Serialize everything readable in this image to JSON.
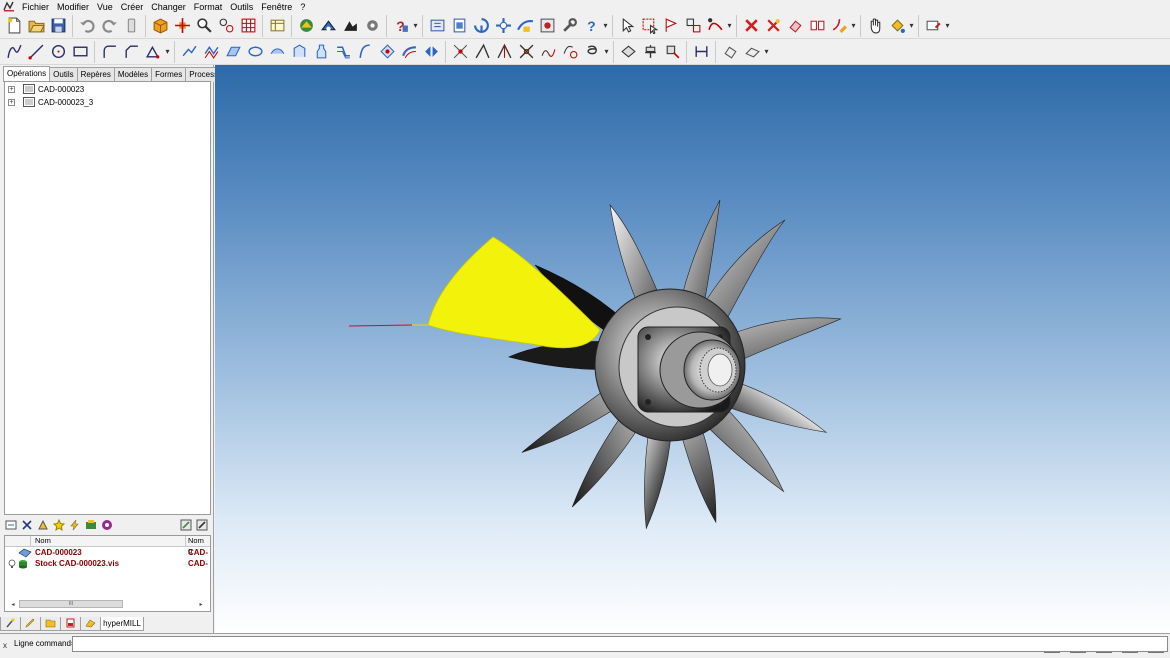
{
  "menu": {
    "items": [
      {
        "label": "Fichier"
      },
      {
        "label": "Modifier"
      },
      {
        "label": "Vue"
      },
      {
        "label": "Créer"
      },
      {
        "label": "Changer"
      },
      {
        "label": "Format"
      },
      {
        "label": "Outils"
      },
      {
        "label": "Fenêtre"
      },
      {
        "label": "?"
      }
    ]
  },
  "left_panel": {
    "tabs": [
      {
        "label": "Opérations"
      },
      {
        "label": "Outils"
      },
      {
        "label": "Repères"
      },
      {
        "label": "Modèles"
      },
      {
        "label": "Formes"
      },
      {
        "label": "Processus"
      }
    ],
    "tree": [
      {
        "label": "CAD-000023",
        "expand": "+"
      },
      {
        "label": "CAD-000023_3",
        "expand": "+"
      }
    ],
    "list": {
      "headers": {
        "name": "Nom",
        "name2": "Nom g"
      },
      "rows": [
        {
          "name": "CAD-000023",
          "name2": "CAD-"
        },
        {
          "name": "Stock CAD-000023.vis",
          "name2": "CAD-"
        }
      ]
    },
    "scroll_thumb": "III",
    "bottom_tab_label": "hyperMILL"
  },
  "command": {
    "close": "x",
    "label": "Ligne command="
  },
  "colors": {
    "viewport_top": "#2d6aa8",
    "viewport_bottom": "#ffffff",
    "highlight": "#f2f20a",
    "list_text": "#8b0000"
  }
}
